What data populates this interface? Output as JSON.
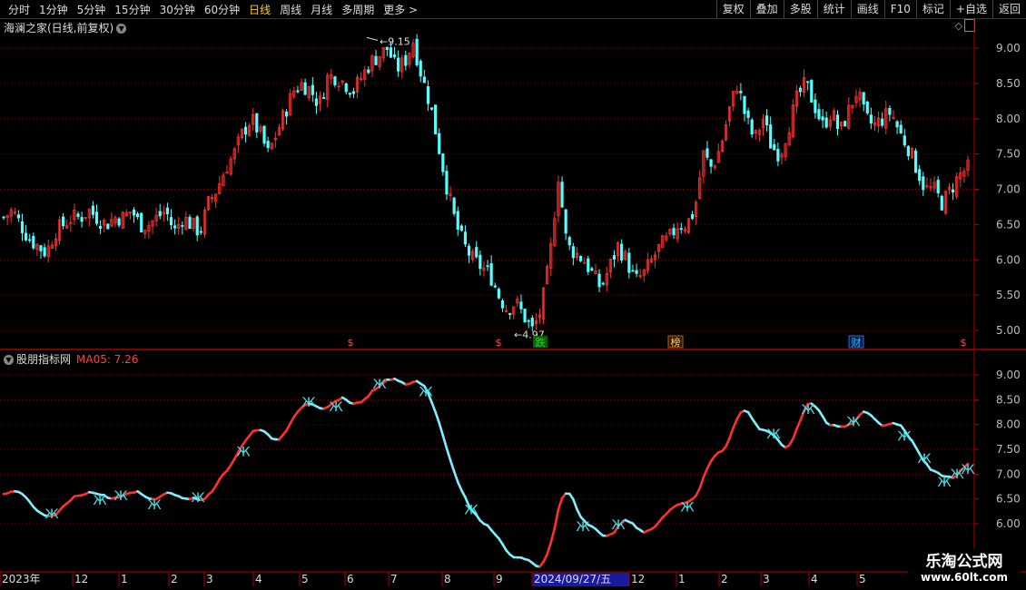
{
  "toolbar": {
    "periods": [
      "分时",
      "1分钟",
      "5分钟",
      "15分钟",
      "30分钟",
      "60分钟",
      "日线",
      "周线",
      "月线",
      "多周期",
      "更多 >"
    ],
    "active_period": "日线",
    "buttons": [
      "复权",
      "叠加",
      "多股",
      "统计",
      "画线",
      "F10",
      "标记",
      "+自选",
      "返回"
    ]
  },
  "main_panel": {
    "title": "海澜之家(日线,前复权)",
    "high_label": "9.15",
    "low_label": "4.97",
    "markers": [
      "$",
      "$",
      "跌",
      "$",
      "财",
      "$"
    ],
    "marker_labels": {
      "die": "跌",
      "bang": "榜",
      "cai": "财",
      "dollar": "$"
    }
  },
  "indicator_panel": {
    "title": "股朋指标网",
    "ma_label": "MA05: 7.26"
  },
  "y_axis_main": [
    "9.00",
    "8.50",
    "8.00",
    "7.50",
    "7.00",
    "6.50",
    "6.00",
    "5.50",
    "5.00"
  ],
  "y_axis_ind": [
    "9.00",
    "8.50",
    "8.00",
    "7.50",
    "7.00",
    "6.50",
    "6.00"
  ],
  "x_axis": {
    "labels": [
      "2023年",
      "12",
      "1",
      "2",
      "3",
      "4",
      "5",
      "6",
      "7",
      "8",
      "9",
      "2024/09/27/五",
      "12",
      "1",
      "2",
      "3",
      "4",
      "5"
    ]
  },
  "watermark": {
    "title": "乐淘公式网",
    "url": "www.60lt.com"
  },
  "colors": {
    "up": "#ff3030",
    "down": "#54ffff",
    "axis": "#b00000",
    "grid": "#7a0000",
    "butterfly": "#40e8f0"
  },
  "chart_data": {
    "type": "candlestick",
    "title": "海澜之家(日线,前复权)",
    "ylim": [
      4.8,
      9.2
    ],
    "close_path": [
      6.6,
      6.7,
      6.5,
      6.3,
      6.2,
      6.1,
      6.4,
      6.5,
      6.6,
      6.6,
      6.7,
      6.6,
      6.5,
      6.6,
      6.6,
      6.7,
      6.5,
      6.5,
      6.6,
      6.7,
      6.4,
      6.6,
      6.5,
      6.4,
      6.8,
      7.0,
      7.3,
      7.5,
      7.8,
      8.0,
      7.8,
      7.5,
      7.8,
      8.1,
      8.4,
      8.5,
      8.4,
      8.2,
      8.6,
      8.6,
      8.5,
      8.4,
      8.6,
      8.8,
      8.9,
      9.0,
      8.7,
      8.8,
      9.1,
      8.6,
      8.2,
      7.6,
      7.0,
      6.5,
      6.2,
      6.0,
      5.9,
      5.8,
      5.5,
      5.3,
      5.4,
      5.2,
      5.0,
      5.3,
      6.0,
      7.2,
      6.2,
      6.1,
      6.0,
      5.8,
      5.6,
      5.9,
      6.2,
      6.0,
      5.7,
      5.8,
      6.0,
      6.2,
      6.3,
      6.5,
      6.5,
      6.7,
      7.5,
      7.3,
      7.6,
      8.1,
      8.5,
      8.0,
      7.7,
      8.0,
      7.6,
      7.5,
      7.9,
      8.3,
      8.5,
      8.2,
      7.9,
      8.1,
      7.8,
      8.1,
      8.4,
      8.0,
      7.9,
      8.0,
      8.1,
      7.8,
      7.6,
      7.3,
      7.0,
      7.0,
      6.8,
      7.0,
      7.2,
      7.3
    ],
    "indicator": {
      "name": "MA05",
      "last": 7.26
    }
  }
}
